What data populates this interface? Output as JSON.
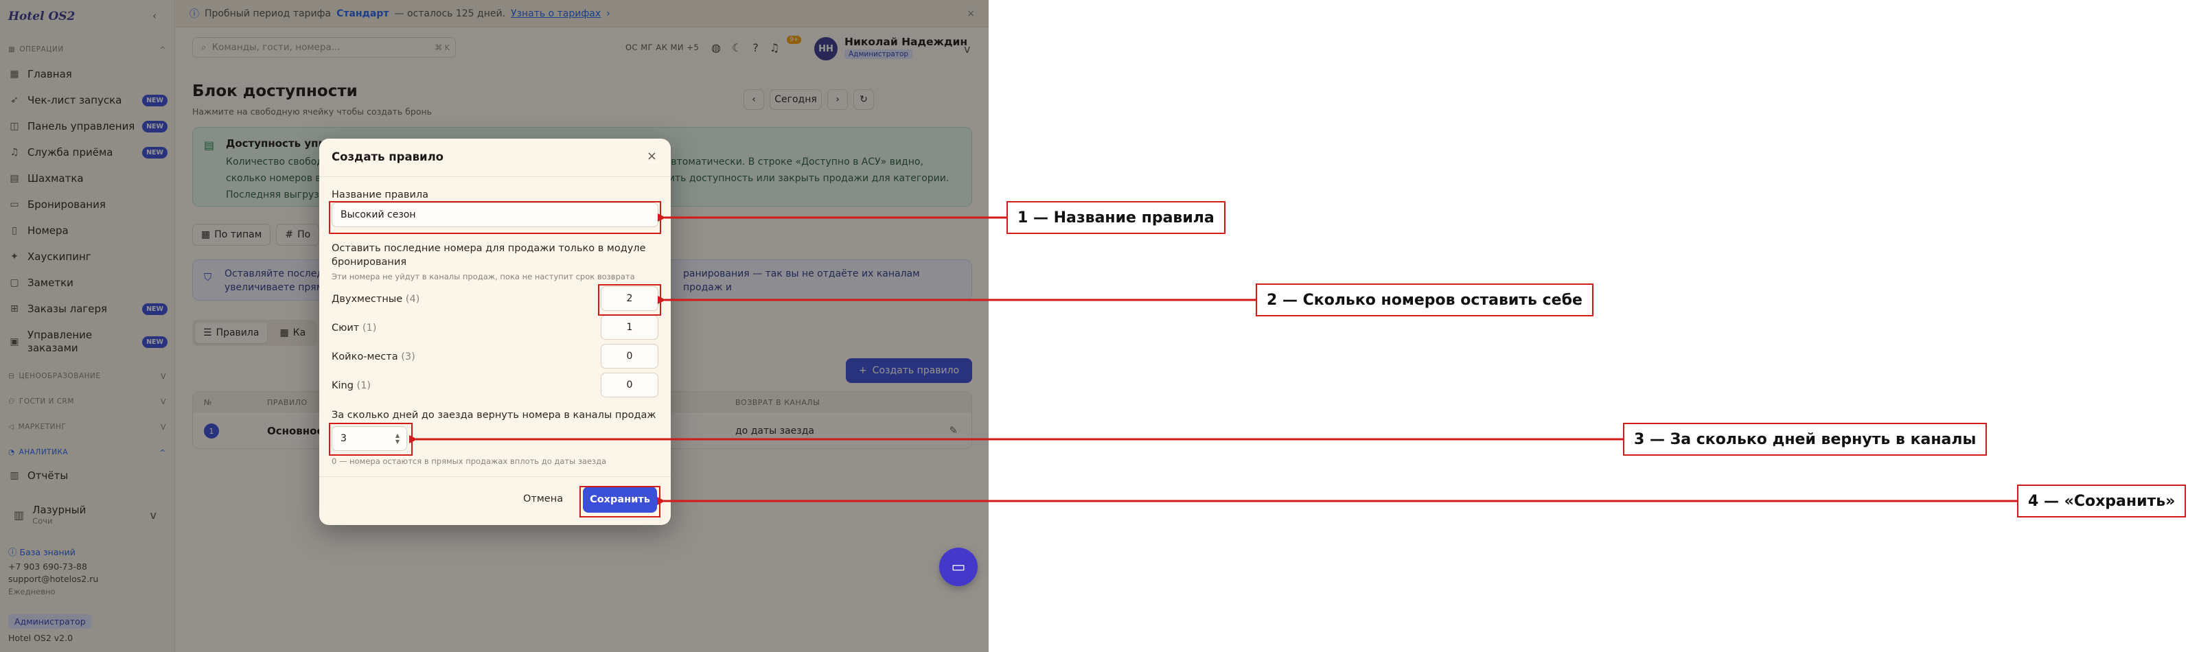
{
  "app": {
    "brand": "Hotel OS2",
    "trial_banner": {
      "text": "Пробный период тарифа",
      "plan": "Стандарт",
      "remaining": "— осталось 125 дней.",
      "link": "Узнать о тарифах"
    }
  },
  "sidebar": {
    "sections": {
      "operations": "Операции",
      "housing": "Ценообразование",
      "guests": "Гости и CRM",
      "marketing": "Маркетинг",
      "analytics": "Аналитика"
    },
    "items": [
      {
        "label": "Главная",
        "icon": "grid-icon",
        "badge": ""
      },
      {
        "label": "Чек-лист запуска",
        "icon": "rocket-icon",
        "badge": "NEW"
      },
      {
        "label": "Панель управления",
        "icon": "dashboard-icon",
        "badge": "NEW"
      },
      {
        "label": "Служба приёма",
        "icon": "bell-icon",
        "badge": "NEW"
      },
      {
        "label": "Шахматка",
        "icon": "calendar-icon",
        "badge": ""
      },
      {
        "label": "Бронирования",
        "icon": "book-icon",
        "badge": ""
      },
      {
        "label": "Номера",
        "icon": "door-icon",
        "badge": ""
      },
      {
        "label": "Хаускипинг",
        "icon": "broom-icon",
        "badge": ""
      },
      {
        "label": "Заметки",
        "icon": "note-icon",
        "badge": ""
      },
      {
        "label": "Заказы лагеря",
        "icon": "cart-icon",
        "badge": "NEW"
      },
      {
        "label": "Управление заказами",
        "icon": "clipboard-icon",
        "badge": "NEW"
      }
    ],
    "analytics_items": [
      {
        "label": "Отчёты",
        "icon": "chart-icon"
      }
    ],
    "hotel": {
      "name": "Лазурный",
      "city": "Сочи"
    },
    "footer": {
      "kb": "База знаний",
      "phone": "+7 903 690-73-88",
      "email": "support@hotelos2.ru",
      "daily": "Ежедневно",
      "role": "Администратор",
      "version": "Hotel OS2 v2.0"
    }
  },
  "header": {
    "search_placeholder": "Команды, гости, номера...",
    "search_kbd": "⌘ K",
    "os_list": "OC МГ АК МИ +5",
    "notif_count": "9+",
    "avatar": "НН",
    "user_name": "Николай Надеждин",
    "user_role": "Администратор"
  },
  "page": {
    "title": "Блок доступности",
    "subtitle": "Нажмите на свободную ячейку чтобы создать бронь",
    "today": "Сегодня",
    "info": {
      "title": "Доступность управл",
      "line1_a": "Количество свобод",
      "line1_b": "ляется автоматически. В строке «Доступно в АСУ» видно,",
      "line2_a": "сколько номеров в",
      "line2_b": "ограничить доступность или закрыть продажи для категории.",
      "line3": "Последняя выгрузк"
    },
    "type_tabs": [
      "По типам",
      "По"
    ],
    "tip": {
      "line1_a": "Оставляйте послед",
      "line1_b": "ранирования — так вы не отдаёте их каналам продаж и",
      "line2": "увеличиваете прям"
    },
    "rule_tabs": [
      "Правила",
      "Ка"
    ],
    "create_rule": "Создать правило",
    "table": {
      "col_num": "№",
      "col_rule": "Правило",
      "col_return": "Возврат в каналы",
      "row": {
        "num": "1",
        "name": "Основное",
        "return": "до даты заезда"
      }
    }
  },
  "modal": {
    "title": "Создать правило",
    "name_label": "Название правила",
    "name_value": "Высокий сезон",
    "keep_label": "Оставить последние номера для продажи только в модуле бронирования",
    "keep_hint": "Эти номера не уйдут в каналы продаж, пока не наступит срок возврата",
    "categories": [
      {
        "name": "Двухместные",
        "count": "(4)",
        "value": "2"
      },
      {
        "name": "Сюит",
        "count": "(1)",
        "value": "1"
      },
      {
        "name": "Койко-места",
        "count": "(3)",
        "value": "0"
      },
      {
        "name": "King",
        "count": "(1)",
        "value": "0"
      }
    ],
    "days_label": "За сколько дней до заезда вернуть номера в каналы продаж",
    "days_value": "3",
    "days_hint": "0 — номера остаются в прямых продажах вплоть до даты заезда",
    "cancel": "Отмена",
    "save": "Сохранить"
  },
  "callouts": [
    "1 — Название правила",
    "2 — Сколько номеров оставить себе",
    "3 — За сколько дней вернуть в каналы",
    "4 — «Сохранить»"
  ],
  "colors": {
    "accent": "#3b4fd8",
    "annotation": "#d11a1a"
  }
}
